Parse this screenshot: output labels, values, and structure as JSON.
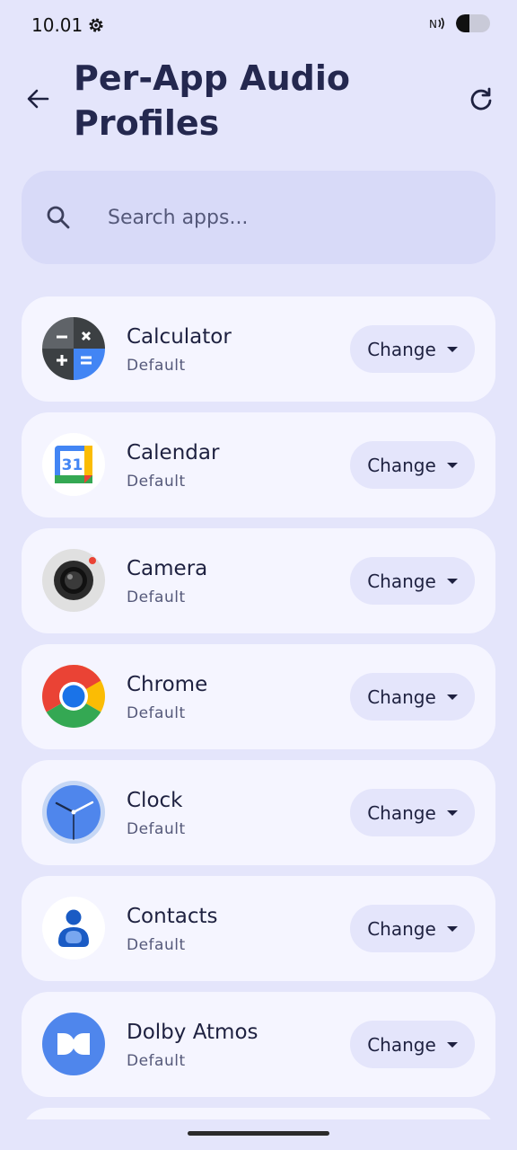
{
  "status": {
    "time": "10.01",
    "battery_percent": 40
  },
  "header": {
    "title": "Per-App Audio Profiles"
  },
  "search": {
    "placeholder": "Search apps..."
  },
  "apps": [
    {
      "name": "Calculator",
      "profile": "Default",
      "button": "Change",
      "icon": "calculator-icon"
    },
    {
      "name": "Calendar",
      "profile": "Default",
      "button": "Change",
      "icon": "calendar-icon",
      "icon_text": "31"
    },
    {
      "name": "Camera",
      "profile": "Default",
      "button": "Change",
      "icon": "camera-icon"
    },
    {
      "name": "Chrome",
      "profile": "Default",
      "button": "Change",
      "icon": "chrome-icon"
    },
    {
      "name": "Clock",
      "profile": "Default",
      "button": "Change",
      "icon": "clock-icon"
    },
    {
      "name": "Contacts",
      "profile": "Default",
      "button": "Change",
      "icon": "contacts-icon"
    },
    {
      "name": "Dolby Atmos",
      "profile": "Default",
      "button": "Change",
      "icon": "dolby-atmos-icon"
    }
  ],
  "colors": {
    "background": "#e4e5fb",
    "card": "#f5f5ff",
    "search": "#d8daf8",
    "text": "#1e2140"
  }
}
